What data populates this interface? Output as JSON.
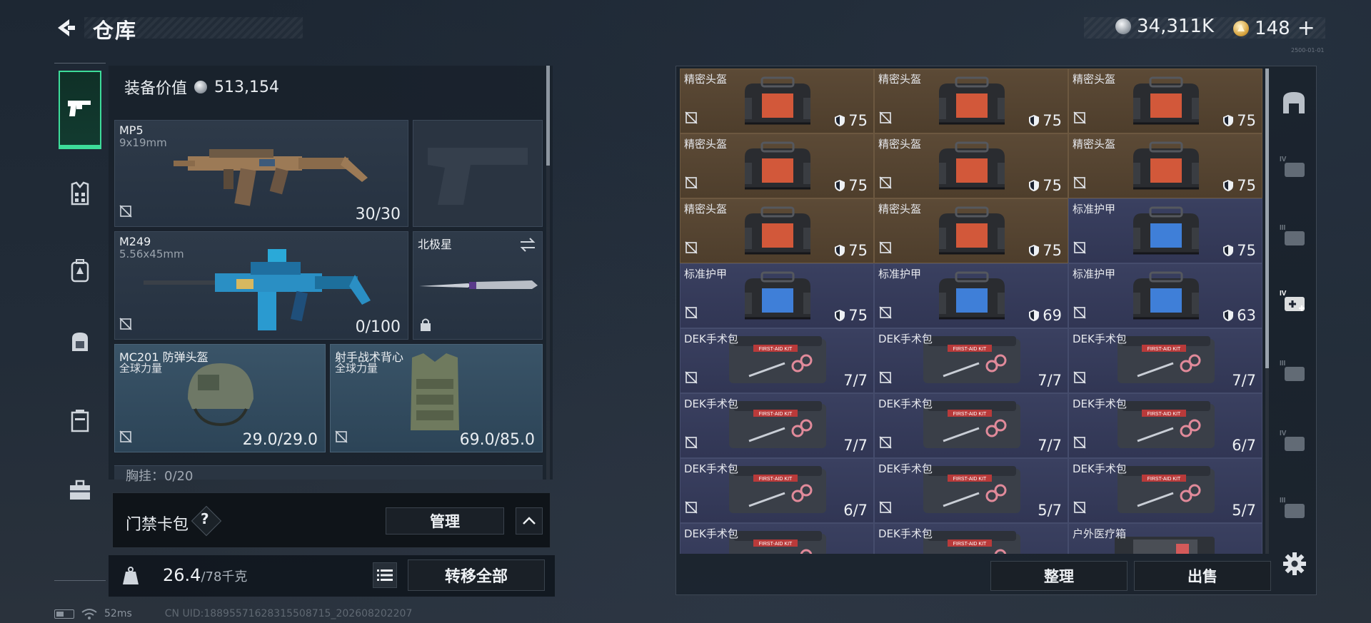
{
  "header": {
    "title": "仓库",
    "currency_silver": "34,311K",
    "currency_gold": "148",
    "gold_plus": "+",
    "version_mark": "2500-01-01"
  },
  "sidebar": {
    "items": [
      {
        "icon": "pistol-icon",
        "active": true
      },
      {
        "icon": "vest-icon"
      },
      {
        "icon": "backpack-icon"
      },
      {
        "icon": "gear-bag-icon"
      },
      {
        "icon": "container-icon"
      },
      {
        "icon": "toolbox-icon"
      }
    ]
  },
  "equipment": {
    "value_label": "装备价值",
    "value": "513,154",
    "primary": {
      "name": "MP5",
      "caliber": "9x19mm",
      "ammo": "30/30"
    },
    "secondary_empty": true,
    "primary2": {
      "name": "M249",
      "caliber": "5.56x45mm",
      "ammo": "0/100"
    },
    "melee": {
      "name": "北极星"
    },
    "helmet": {
      "name": "MC201 防弹头盔",
      "brand": "全球力量",
      "durability": "29.0/29.0"
    },
    "armor": {
      "name": "射手战术背心",
      "brand": "全球力量",
      "durability": "69.0/85.0"
    },
    "chest_rig": {
      "label": "胸挂：0/20"
    }
  },
  "keycard": {
    "label": "门禁卡包",
    "help": "?",
    "manage_label": "管理"
  },
  "weight": {
    "current": "26.4",
    "max": "/78千克",
    "transfer_label": "转移全部"
  },
  "status": {
    "ping": "52ms",
    "uid": "CN UID:18895571628315508715_202608202207"
  },
  "warehouse": {
    "items": [
      {
        "name": "精密头盔",
        "value": "75",
        "type": "helmet",
        "rarity": "gold"
      },
      {
        "name": "精密头盔",
        "value": "75",
        "type": "helmet",
        "rarity": "gold"
      },
      {
        "name": "精密头盔",
        "value": "75",
        "type": "helmet",
        "rarity": "gold"
      },
      {
        "name": "精密头盔",
        "value": "75",
        "type": "helmet",
        "rarity": "gold"
      },
      {
        "name": "精密头盔",
        "value": "75",
        "type": "helmet",
        "rarity": "gold"
      },
      {
        "name": "精密头盔",
        "value": "75",
        "type": "helmet",
        "rarity": "gold"
      },
      {
        "name": "精密头盔",
        "value": "75",
        "type": "helmet",
        "rarity": "gold"
      },
      {
        "name": "精密头盔",
        "value": "75",
        "type": "helmet",
        "rarity": "gold"
      },
      {
        "name": "标准护甲",
        "value": "75",
        "type": "armor",
        "rarity": "blue"
      },
      {
        "name": "标准护甲",
        "value": "75",
        "type": "armor",
        "rarity": "blue"
      },
      {
        "name": "标准护甲",
        "value": "69",
        "type": "armor",
        "rarity": "blue"
      },
      {
        "name": "标准护甲",
        "value": "63",
        "type": "armor",
        "rarity": "blue"
      },
      {
        "name": "DEK手术包",
        "value": "7/7",
        "type": "kit",
        "rarity": "blue"
      },
      {
        "name": "DEK手术包",
        "value": "7/7",
        "type": "kit",
        "rarity": "blue"
      },
      {
        "name": "DEK手术包",
        "value": "7/7",
        "type": "kit",
        "rarity": "blue"
      },
      {
        "name": "DEK手术包",
        "value": "7/7",
        "type": "kit",
        "rarity": "blue"
      },
      {
        "name": "DEK手术包",
        "value": "7/7",
        "type": "kit",
        "rarity": "blue"
      },
      {
        "name": "DEK手术包",
        "value": "6/7",
        "type": "kit",
        "rarity": "blue"
      },
      {
        "name": "DEK手术包",
        "value": "6/7",
        "type": "kit",
        "rarity": "blue"
      },
      {
        "name": "DEK手术包",
        "value": "5/7",
        "type": "kit",
        "rarity": "blue"
      },
      {
        "name": "DEK手术包",
        "value": "5/7",
        "type": "kit",
        "rarity": "blue"
      },
      {
        "name": "DEK手术包",
        "value": "",
        "type": "kit",
        "rarity": "blue"
      },
      {
        "name": "DEK手术包",
        "value": "",
        "type": "kit",
        "rarity": "blue"
      },
      {
        "name": "户外医疗箱",
        "value": "",
        "type": "medbox",
        "rarity": "blue"
      }
    ],
    "kit_label": "FIRST-AID KIT",
    "sort_label": "整理",
    "sell_label": "出售"
  },
  "filters": {
    "items": [
      {
        "icon": "all-items-icon"
      },
      {
        "icon": "tier-iv-filter-icon",
        "tier": "IV"
      },
      {
        "icon": "tier-iii-filter-icon",
        "tier": "III"
      },
      {
        "icon": "tier-iv-medical-filter-icon",
        "tier": "IV"
      },
      {
        "icon": "tier-iii-medical-filter-icon",
        "tier": "III"
      },
      {
        "icon": "tier-iv-supply-filter-icon",
        "tier": "IV"
      },
      {
        "icon": "tier-iii-supply-filter-icon",
        "tier": "III"
      }
    ]
  },
  "colors": {
    "accent_green": "#3ddc9a",
    "rarity_gold": "#5c4a36",
    "rarity_blue": "#3a4060"
  }
}
